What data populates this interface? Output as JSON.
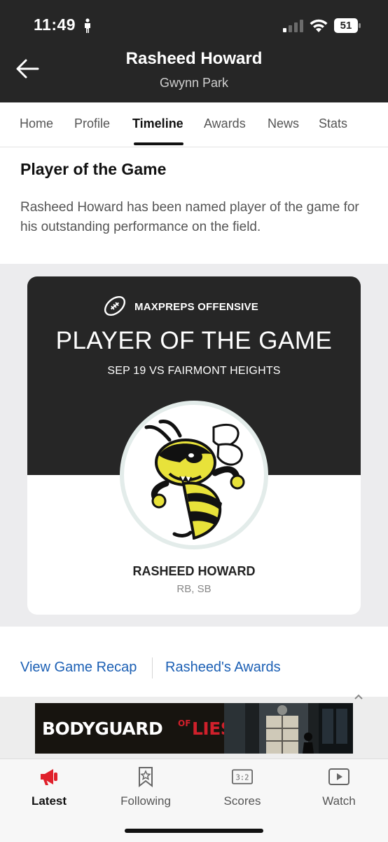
{
  "status_bar": {
    "time": "11:49",
    "battery": "51"
  },
  "header": {
    "title": "Rasheed Howard",
    "subtitle": "Gwynn Park"
  },
  "tabs": [
    {
      "label": "Home"
    },
    {
      "label": "Profile"
    },
    {
      "label": "Timeline",
      "active": true
    },
    {
      "label": "Awards"
    },
    {
      "label": "News"
    },
    {
      "label": "Stats"
    }
  ],
  "award": {
    "heading": "Player of the Game",
    "description": "Rasheed Howard has been named player of the game for his outstanding performance on the field.",
    "card": {
      "brand": "MAXPREPS OFFENSIVE",
      "title": "PLAYER OF THE GAME",
      "game": "SEP 19 VS FAIRMONT HEIGHTS",
      "player_name": "RASHEED HOWARD",
      "positions": "RB, SB"
    }
  },
  "links": {
    "recap": "View Game Recap",
    "awards": "Rasheed's Awards"
  },
  "ad": {
    "text_white": "BODYGUARD",
    "text_of": "OF",
    "text_red": "LIES"
  },
  "bottom_nav": [
    {
      "label": "Latest",
      "icon": "megaphone-icon",
      "active": true
    },
    {
      "label": "Following",
      "icon": "bookmark-star-icon"
    },
    {
      "label": "Scores",
      "icon": "scoreboard-icon"
    },
    {
      "label": "Watch",
      "icon": "play-icon"
    }
  ],
  "colors": {
    "header_bg": "#262626",
    "link": "#1b5fb4",
    "accent_red": "#e0202b"
  }
}
